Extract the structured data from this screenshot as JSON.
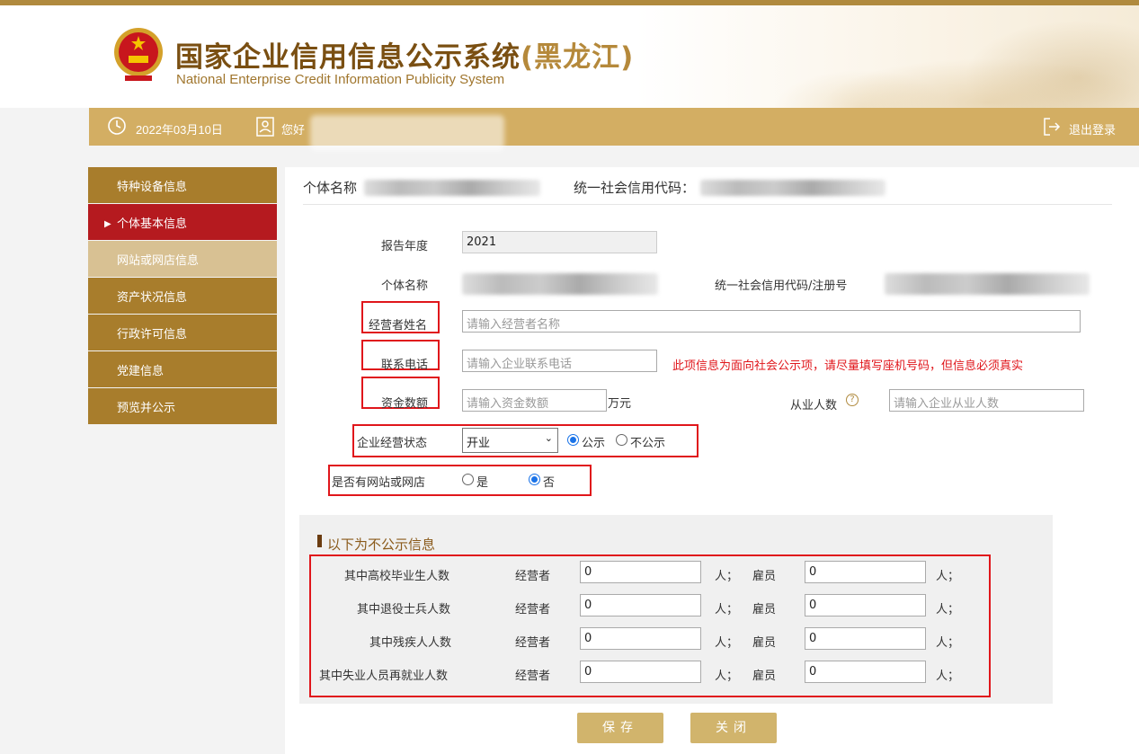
{
  "header": {
    "title_cn": "国家企业信用信息公示系统",
    "region": "(黑龙江)",
    "title_en": "National Enterprise Credit Information Publicity System"
  },
  "userbar": {
    "date": "2022年03月10日",
    "greeting": "您好",
    "logout": "退出登录"
  },
  "sidebar": {
    "items": [
      {
        "label": "特种设备信息"
      },
      {
        "label": "个体基本信息"
      },
      {
        "label": "网站或网店信息"
      },
      {
        "label": "资产状况信息"
      },
      {
        "label": "行政许可信息"
      },
      {
        "label": "党建信息"
      },
      {
        "label": "预览并公示"
      }
    ]
  },
  "main": {
    "header": {
      "name_label": "个体名称",
      "credit_label": "统一社会信用代码："
    },
    "form": {
      "year_label": "报告年度",
      "year_value": "2021",
      "name_label": "个体名称",
      "credit_label": "统一社会信用代码/注册号",
      "operator_label": "经营者姓名",
      "operator_placeholder": "请输入经营者名称",
      "phone_label": "联系电话",
      "phone_placeholder": "请输入企业联系电话",
      "phone_note": "此项信息为面向社会公示项，请尽量填写座机号码，但信息必须真实",
      "capital_label": "资金数额",
      "capital_placeholder": "请输入资金数额",
      "capital_unit": "万元",
      "employees_label": "从业人数",
      "employees_placeholder": "请输入企业从业人数",
      "status_label": "企业经营状态",
      "status_value": "开业",
      "public_label": "公示",
      "not_public_label": "不公示",
      "website_label": "是否有网站或网店",
      "yes_label": "是",
      "no_label": "否"
    },
    "private_section": {
      "title": "以下为不公示信息",
      "operator_label": "经营者",
      "employee_label": "雇员",
      "unit": "人；",
      "rows": [
        {
          "label": "其中高校毕业生人数",
          "operator": "0",
          "employee": "0"
        },
        {
          "label": "其中退役士兵人数",
          "operator": "0",
          "employee": "0"
        },
        {
          "label": "其中残疾人人数",
          "operator": "0",
          "employee": "0"
        },
        {
          "label": "其中失业人员再就业人数",
          "operator": "0",
          "employee": "0"
        }
      ]
    },
    "buttons": {
      "save": "保存",
      "close": "关闭"
    }
  }
}
